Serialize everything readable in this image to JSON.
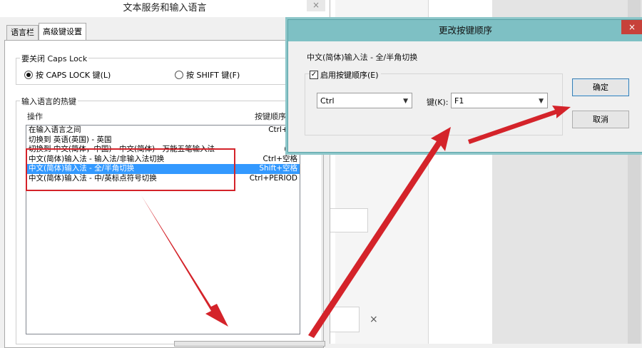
{
  "left_dialog": {
    "title": "文本服务和输入语言",
    "close": "×",
    "tabs": [
      "语言栏",
      "高级键设置"
    ],
    "caps_group": {
      "label": "要关闭 Caps Lock",
      "option1": "按 CAPS LOCK 键(L)",
      "option2": "按 SHIFT 键(F)"
    },
    "hotkey_group": {
      "label": "输入语言的热键",
      "col_action": "操作",
      "col_hotkey": "按键顺序"
    },
    "rows": [
      {
        "action": "在输入语言之间",
        "hotkey": "Ctrl+Sh"
      },
      {
        "action": "切换到 英语(英国) - 英国",
        "hotkey": "("
      },
      {
        "action": "切换到 中文(简体，中国) - 中文(简体) - 万能五笔输入法",
        "hotkey": "(无)"
      },
      {
        "action": "中文(简体)输入法 - 输入法/非输入法切换",
        "hotkey": "Ctrl+空格"
      },
      {
        "action": "中文(简体)输入法 - 全/半角切换",
        "hotkey": "Shift+空格"
      },
      {
        "action": "中文(简体)输入法 - 中/英标点符号切换",
        "hotkey": "Ctrl+PERIOD"
      }
    ]
  },
  "right_dialog": {
    "title": "更改按键顺序",
    "close": "×",
    "action_label": "中文(简体)输入法 - 全/半角切换",
    "enable_checkbox": "启用按键顺序(E)",
    "modifier_value": "Ctrl",
    "key_label": "键(K):",
    "key_value": "F1",
    "ok_button": "确定",
    "cancel_button": "取消"
  },
  "background": {
    "close_glyph": "×"
  },
  "colors": {
    "selection": "#3399ff",
    "annotation_red": "#d4232a",
    "titlebar_teal": "#7ec0c4",
    "close_red": "#c7413a"
  }
}
